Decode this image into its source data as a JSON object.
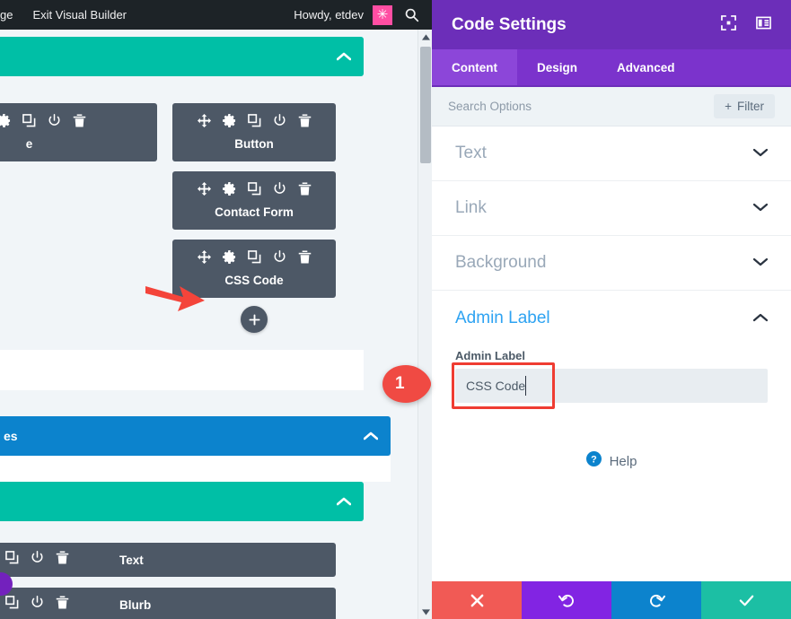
{
  "adminbar": {
    "left_items": [
      "ge",
      "Exit Visual Builder"
    ],
    "howdy": "Howdy, etdev",
    "avatar_glyph": "✳",
    "search_icon": "search-icon"
  },
  "canvas": {
    "sections": [
      {
        "id": "section-top",
        "label": "",
        "color": "#00bfa6",
        "collapse_icon": "chevron-up-icon"
      },
      {
        "id": "section-blue",
        "label": "es",
        "color": "#0c83cd",
        "collapse_icon": "chevron-up-icon"
      },
      {
        "id": "section-bottom",
        "label": "",
        "color": "#00bfa6",
        "collapse_icon": "chevron-up-icon"
      }
    ],
    "module_icons": [
      "move-icon",
      "gear-icon",
      "duplicate-icon",
      "power-icon",
      "trash-icon"
    ],
    "modules": [
      {
        "id": "module-partial-left",
        "label": "e"
      },
      {
        "id": "module-button",
        "label": "Button"
      },
      {
        "id": "module-contact-form",
        "label": "Contact Form"
      },
      {
        "id": "module-css-code",
        "label": "CSS Code"
      },
      {
        "id": "module-text",
        "label": "Text"
      },
      {
        "id": "module-blurb",
        "label": "Blurb"
      }
    ],
    "add_module_glyph": "+",
    "annotation": {
      "type": "red-arrow",
      "points_to": "module-css-code"
    }
  },
  "scrollbar": {
    "up_glyph": "▲",
    "down_glyph": "▼"
  },
  "panel": {
    "title": "Code Settings",
    "header_icons": [
      "focus-mode-icon",
      "panel-layout-icon"
    ],
    "tabs": [
      {
        "label": "Content",
        "active": true
      },
      {
        "label": "Design",
        "active": false
      },
      {
        "label": "Advanced",
        "active": false
      }
    ],
    "search": {
      "placeholder": "Search Options",
      "value": ""
    },
    "filter_button": {
      "label": "Filter",
      "glyph": "+"
    },
    "sections": [
      {
        "label": "Text",
        "open": false,
        "chevron": "chevron-down-icon"
      },
      {
        "label": "Link",
        "open": false,
        "chevron": "chevron-down-icon"
      },
      {
        "label": "Background",
        "open": false,
        "chevron": "chevron-down-icon"
      },
      {
        "label": "Admin Label",
        "open": true,
        "chevron": "chevron-up-icon"
      }
    ],
    "admin_label_field": {
      "label": "Admin Label",
      "value": "CSS Code",
      "placeholder": ""
    },
    "help": {
      "label": "Help",
      "icon": "question-circle-icon"
    },
    "actions": [
      {
        "name": "cancel",
        "glyph": "✖",
        "color": "#f15a55"
      },
      {
        "name": "undo",
        "glyph": "↺",
        "color": "#8224e3"
      },
      {
        "name": "redo",
        "glyph": "↻",
        "color": "#0c83cd"
      },
      {
        "name": "save",
        "glyph": "✔",
        "color": "#1cbfa4"
      }
    ]
  },
  "step_marker": {
    "number": "1",
    "color": "#f04a43"
  },
  "colors": {
    "purple_header": "#6c2eb9",
    "tab_bar": "#7b33cc",
    "tab_active": "#8c46d9",
    "teal": "#00bfa6",
    "blue": "#0c83cd",
    "module_dark": "#4d5866",
    "canvas_bg": "#f1f5f8",
    "annotation_red": "#ef3c32",
    "link_blue": "#2ea3f2"
  }
}
